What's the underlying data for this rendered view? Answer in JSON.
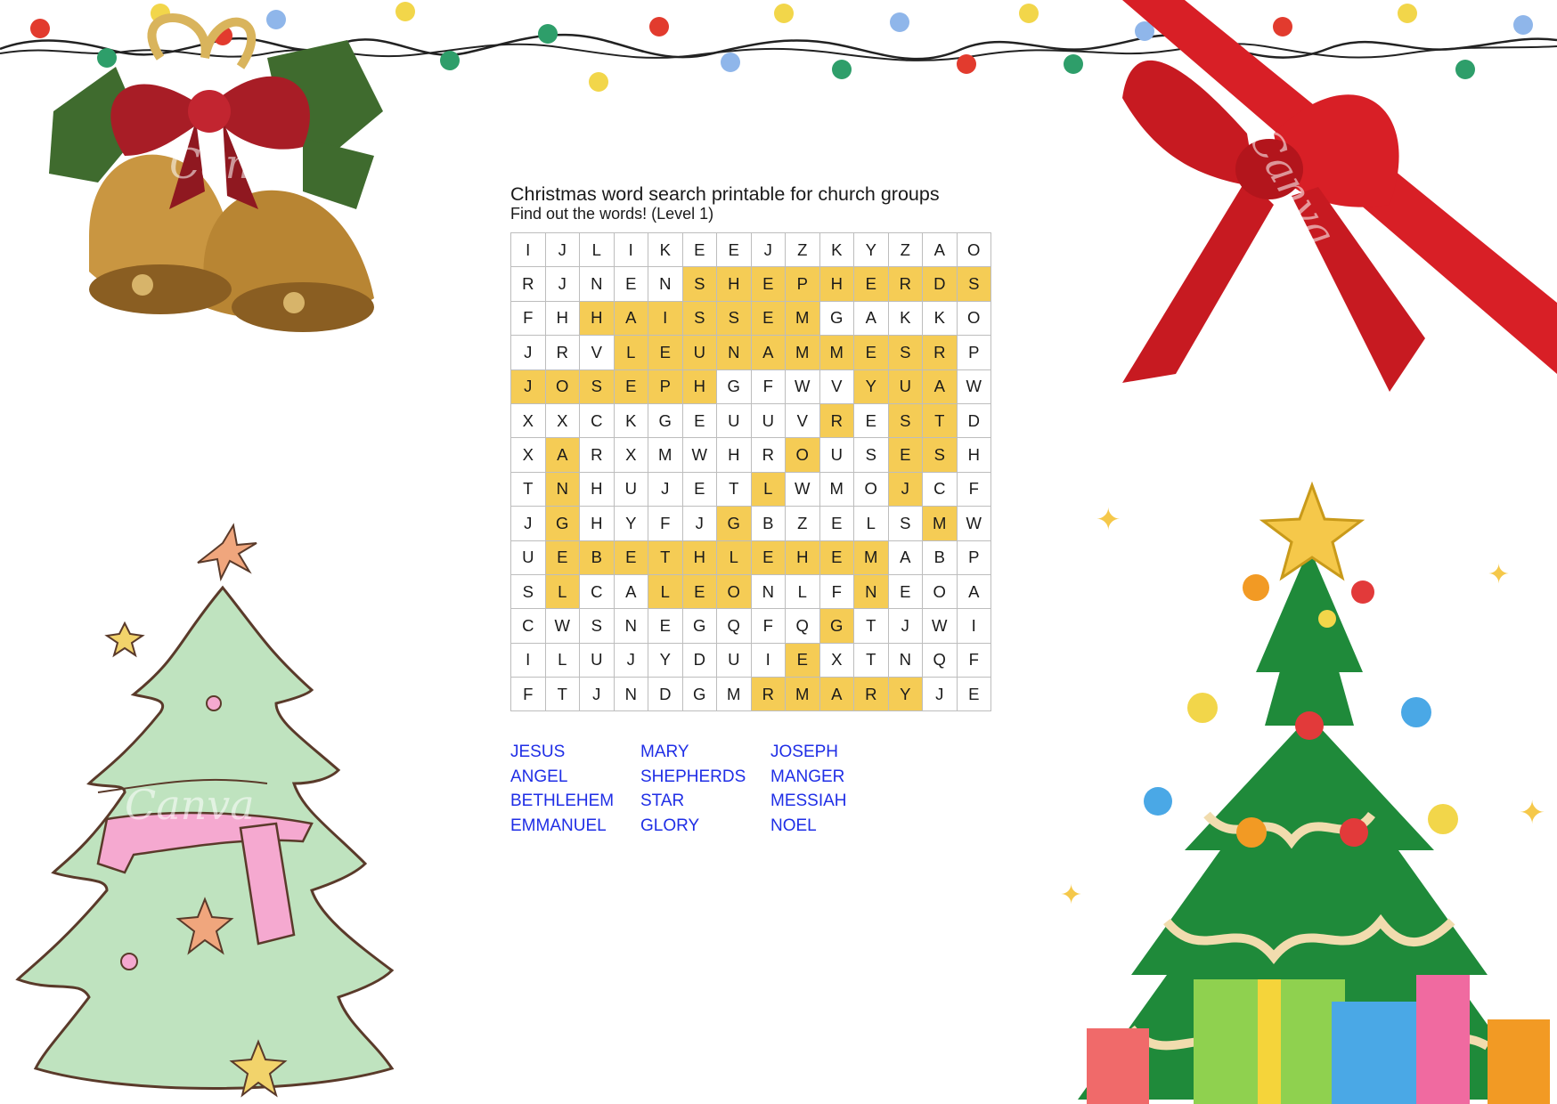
{
  "title": "Christmas word search printable for church groups",
  "subtitle": "Find out the words! (Level 1)",
  "grid": [
    [
      "I",
      "J",
      "L",
      "I",
      "K",
      "E",
      "E",
      "J",
      "Z",
      "K",
      "Y",
      "Z",
      "A",
      "O"
    ],
    [
      "R",
      "J",
      "N",
      "E",
      "N",
      "S",
      "H",
      "E",
      "P",
      "H",
      "E",
      "R",
      "D",
      "S"
    ],
    [
      "F",
      "H",
      "H",
      "A",
      "I",
      "S",
      "S",
      "E",
      "M",
      "G",
      "A",
      "K",
      "K",
      "O"
    ],
    [
      "J",
      "R",
      "V",
      "L",
      "E",
      "U",
      "N",
      "A",
      "M",
      "M",
      "E",
      "S",
      "R",
      "P"
    ],
    [
      "J",
      "O",
      "S",
      "E",
      "P",
      "H",
      "G",
      "F",
      "W",
      "V",
      "Y",
      "U",
      "A",
      "W"
    ],
    [
      "X",
      "X",
      "C",
      "K",
      "G",
      "E",
      "U",
      "U",
      "V",
      "R",
      "E",
      "S",
      "T",
      "D"
    ],
    [
      "X",
      "A",
      "R",
      "X",
      "M",
      "W",
      "H",
      "R",
      "O",
      "U",
      "S",
      "E",
      "S",
      "H"
    ],
    [
      "T",
      "N",
      "H",
      "U",
      "J",
      "E",
      "T",
      "L",
      "W",
      "M",
      "O",
      "J",
      "C",
      "F"
    ],
    [
      "J",
      "G",
      "H",
      "Y",
      "F",
      "J",
      "G",
      "B",
      "Z",
      "E",
      "L",
      "S",
      "M",
      "W"
    ],
    [
      "U",
      "E",
      "B",
      "E",
      "T",
      "H",
      "L",
      "E",
      "H",
      "E",
      "M",
      "A",
      "B",
      "P"
    ],
    [
      "S",
      "L",
      "C",
      "A",
      "L",
      "E",
      "O",
      "N",
      "L",
      "F",
      "N",
      "E",
      "O",
      "A"
    ],
    [
      "C",
      "W",
      "S",
      "N",
      "E",
      "G",
      "Q",
      "F",
      "Q",
      "G",
      "T",
      "J",
      "W",
      "I"
    ],
    [
      "I",
      "L",
      "U",
      "J",
      "Y",
      "D",
      "U",
      "I",
      "E",
      "X",
      "T",
      "N",
      "Q",
      "F"
    ],
    [
      "F",
      "T",
      "J",
      "N",
      "D",
      "G",
      "M",
      "R",
      "M",
      "A",
      "R",
      "Y",
      "J",
      "E"
    ]
  ],
  "highlight": [
    [],
    [
      5,
      6,
      7,
      8,
      9,
      10,
      11,
      12,
      13
    ],
    [
      2,
      3,
      4,
      5,
      6,
      7,
      8
    ],
    [
      3,
      4,
      5,
      6,
      7,
      8,
      9,
      10,
      11,
      12
    ],
    [
      0,
      1,
      2,
      3,
      4,
      5,
      10,
      11,
      12
    ],
    [
      9,
      11,
      12
    ],
    [
      1,
      8,
      11,
      12
    ],
    [
      1,
      7,
      11
    ],
    [
      1,
      6,
      12
    ],
    [
      1,
      2,
      3,
      4,
      5,
      6,
      7,
      8,
      9,
      10
    ],
    [
      1,
      4,
      5,
      6,
      10
    ],
    [
      9
    ],
    [
      8
    ],
    [
      7,
      8,
      9,
      10,
      11
    ]
  ],
  "word_columns": [
    [
      "JESUS",
      "ANGEL",
      "BETHLEHEM",
      "EMMANUEL"
    ],
    [
      "MARY",
      "SHEPHERDS",
      "STAR",
      "GLORY"
    ],
    [
      "JOSEPH",
      "MANGER",
      "MESSIAH",
      "NOEL"
    ]
  ],
  "watermark": "Canva",
  "colors": {
    "highlight": "#f5cc55",
    "word_list": "#1f2ee6",
    "grid_line": "#bdbdbd",
    "ribbon_red": "#d81f26"
  },
  "icons": [
    "string-lights",
    "christmas-bells",
    "red-ribbon-bow",
    "pastel-christmas-tree",
    "decorated-christmas-tree"
  ]
}
